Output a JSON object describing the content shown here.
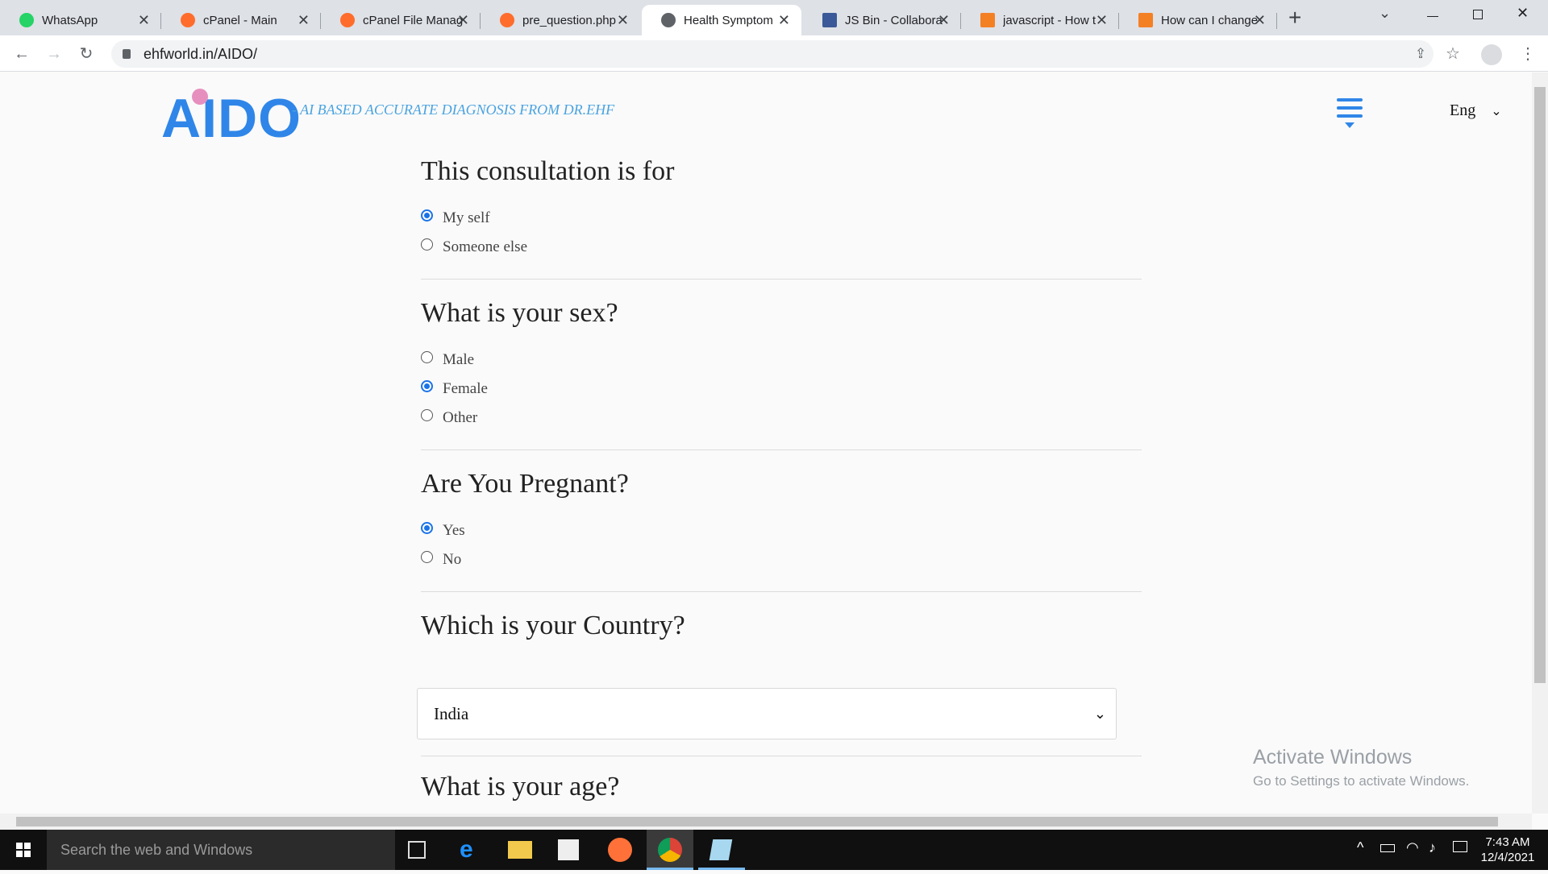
{
  "browser": {
    "tabs": [
      {
        "title": "WhatsApp",
        "favicon_color": "#25d366"
      },
      {
        "title": "cPanel - Main",
        "favicon_color": "#ff6c2c"
      },
      {
        "title": "cPanel File Manag",
        "favicon_color": "#ff6c2c"
      },
      {
        "title": "pre_question.php",
        "favicon_color": "#ff6c2c"
      },
      {
        "title": "Health Symptom",
        "favicon_color": "#5f6368"
      },
      {
        "title": "JS Bin - Collabora",
        "favicon_color": "#3b5998"
      },
      {
        "title": "javascript - How t",
        "favicon_color": "#f48024"
      },
      {
        "title": "How can I change",
        "favicon_color": "#f48024"
      }
    ],
    "url": "ehfworld.in/AIDO/"
  },
  "header": {
    "logo_text": "AIDO",
    "tagline": "- AI BASED ACCURATE DIAGNOSIS FROM DR.EHF",
    "language": "Eng"
  },
  "form": {
    "consultation": {
      "question": "This consultation is for",
      "options": [
        "My self",
        "Someone else"
      ],
      "selected_index": 0
    },
    "sex": {
      "question": "What is your sex?",
      "options": [
        "Male",
        "Female",
        "Other"
      ],
      "selected_index": 1
    },
    "pregnant": {
      "question": "Are You Pregnant?",
      "options": [
        "Yes",
        "No"
      ],
      "selected_index": 0
    },
    "country": {
      "question": "Which is your Country?",
      "selected": "India"
    },
    "age": {
      "question": "What is your age?"
    }
  },
  "watermark": {
    "title": "Activate Windows",
    "subtitle": "Go to Settings to activate Windows."
  },
  "taskbar": {
    "search_placeholder": "Search the web and Windows",
    "time": "7:43 AM",
    "date": "12/4/2021"
  }
}
